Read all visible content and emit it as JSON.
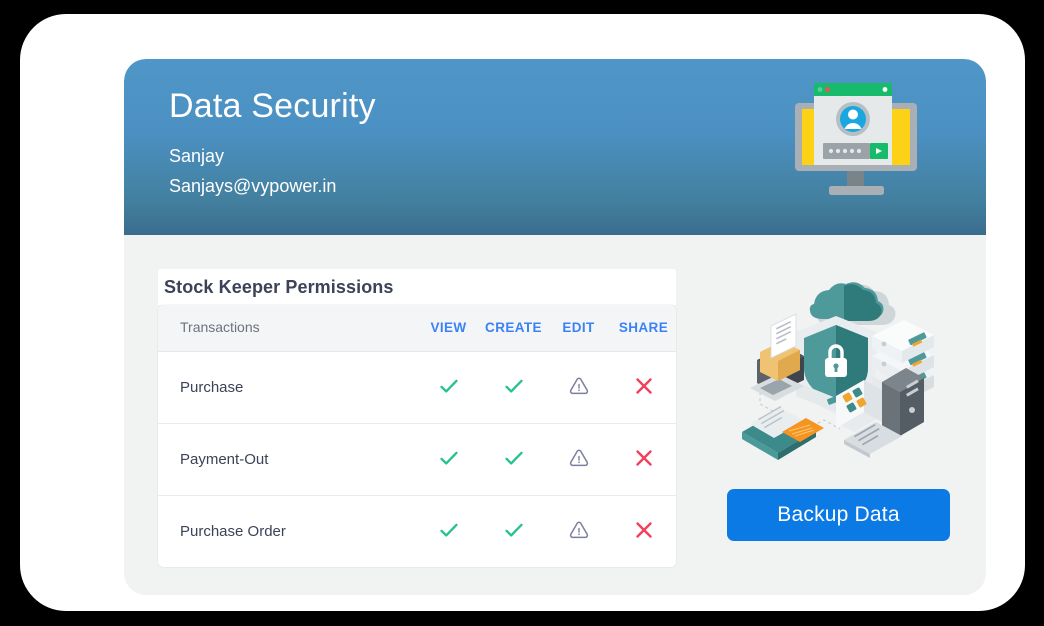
{
  "header": {
    "title": "Data Security",
    "user_name": "Sanjay",
    "user_email": "Sanjays@vypower.in",
    "gradient_top": "#4f97c8",
    "gradient_bottom": "#3a6c8d",
    "illustration_name": "monitor-login-illustration"
  },
  "permissions": {
    "panel_title": "Stock Keeper Permissions",
    "columns": [
      {
        "label": "Transactions",
        "key": "name"
      },
      {
        "label": "VIEW",
        "key": "view"
      },
      {
        "label": "CREATE",
        "key": "create"
      },
      {
        "label": "EDIT",
        "key": "edit"
      },
      {
        "label": "SHARE",
        "key": "share"
      }
    ],
    "column_header_color": "#3b82f6",
    "rows": [
      {
        "name": "Purchase",
        "view": "check",
        "create": "check",
        "edit": "warning",
        "share": "cross"
      },
      {
        "name": "Payment-Out",
        "view": "check",
        "create": "check",
        "edit": "warning",
        "share": "cross"
      },
      {
        "name": "Purchase Order",
        "view": "check",
        "create": "check",
        "edit": "warning",
        "share": "cross"
      }
    ],
    "status_icons": {
      "check": {
        "name": "check-icon",
        "color": "#23c38a"
      },
      "warning": {
        "name": "warning-triangle-icon",
        "color": "#7b7f9e"
      },
      "cross": {
        "name": "cross-icon",
        "color": "#f2405d"
      }
    }
  },
  "right_panel": {
    "illustration_name": "data-security-isometric-illustration",
    "backup_button_label": "Backup Data",
    "backup_button_color": "#0b7ae5"
  }
}
